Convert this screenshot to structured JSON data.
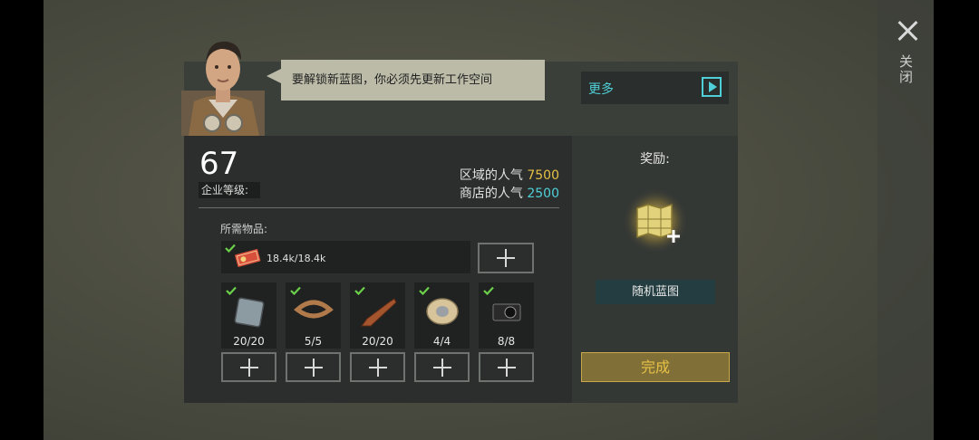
{
  "npc": {
    "speech": "要解锁新蓝图，你必须先更新工作空间"
  },
  "more_button": {
    "label": "更多"
  },
  "close_button": {
    "label": "关闭"
  },
  "level": {
    "value": "67",
    "label": "企业等级:"
  },
  "popularity": {
    "area_label": "区域的人气",
    "area_value": "7500",
    "shop_label": "商店的人气",
    "shop_value": "2500"
  },
  "requirements": {
    "label": "所需物品:",
    "coins": {
      "amount": "18.4k/18.4k",
      "icon": "coupon-icon"
    },
    "items": [
      {
        "name": "metal-plate-icon",
        "count": "20/20"
      },
      {
        "name": "leather-strap-icon",
        "count": "5/5"
      },
      {
        "name": "wooden-stock-icon",
        "count": "20/20"
      },
      {
        "name": "wire-spool-icon",
        "count": "4/4"
      },
      {
        "name": "camera-icon",
        "count": "8/8"
      }
    ]
  },
  "reward": {
    "title": "奖励:",
    "name": "随机蓝图",
    "icon": "blueprint-icon"
  },
  "complete_button": {
    "label": "完成"
  },
  "colors": {
    "accent_cyan": "#4fd0d8",
    "accent_yellow": "#e6c046",
    "check_green": "#6bd04a"
  }
}
